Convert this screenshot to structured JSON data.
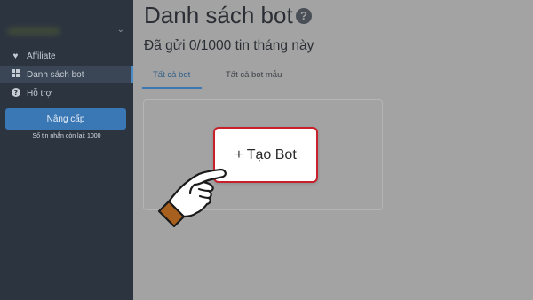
{
  "sidebar": {
    "items": [
      {
        "label": "Affiliate",
        "icon": "heart-icon",
        "active": false
      },
      {
        "label": "Danh sách bot",
        "icon": "grid-icon",
        "active": true
      },
      {
        "label": "Hỗ trợ",
        "icon": "question-circle-icon",
        "active": false
      }
    ],
    "upgrade_label": "Nâng cấp",
    "remaining_text": "Số tin nhắn còn lại: 1000"
  },
  "main": {
    "title": "Danh sách bot",
    "sent_status": "Đã gửi 0/1000 tin tháng này",
    "tabs": [
      {
        "label": "Tất cả bot",
        "active": true
      },
      {
        "label": "Tất cả bot mẫu",
        "active": false
      }
    ],
    "create_bot_label": "+ Tạo Bot"
  },
  "colors": {
    "sidebar_bg": "#2c3440",
    "overlay_bg": "#a3a3a3",
    "accent": "#3a77b5",
    "highlight_border": "#c8212c"
  }
}
